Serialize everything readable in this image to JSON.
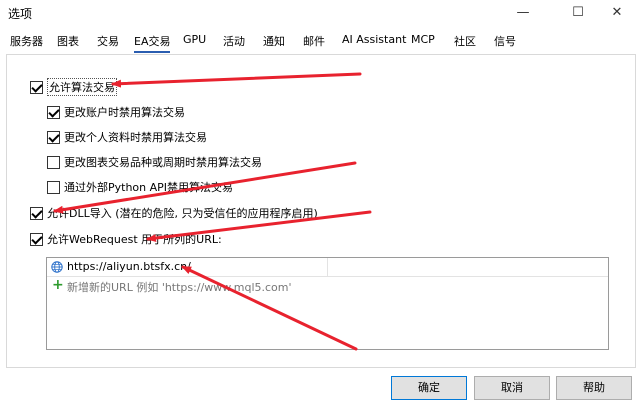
{
  "window": {
    "title": "选项",
    "minimize_glyph": "—",
    "maximize_glyph": "☐",
    "close_glyph": "✕"
  },
  "tabs": [
    {
      "label": "服务器"
    },
    {
      "label": "图表"
    },
    {
      "label": "交易"
    },
    {
      "label": "EA交易",
      "active": true
    },
    {
      "label": "GPU"
    },
    {
      "label": "活动"
    },
    {
      "label": "通知"
    },
    {
      "label": "邮件"
    },
    {
      "label": "AI Assistant"
    },
    {
      "label": "MCP"
    },
    {
      "label": "社区"
    },
    {
      "label": "信号"
    }
  ],
  "options": {
    "allow_algo": {
      "label": "允许算法交易",
      "checked": true
    },
    "disable_on_account_change": {
      "label": "更改账户时禁用算法交易",
      "checked": true
    },
    "disable_on_profile_change": {
      "label": "更改个人资料时禁用算法交易",
      "checked": true
    },
    "disable_on_symbol_change": {
      "label": "更改图表交易品种或周期时禁用算法交易",
      "checked": false
    },
    "disable_external_python": {
      "label": "通过外部Python API禁用算法交易",
      "checked": false
    },
    "allow_dll": {
      "label": "允许DLL导入 (潜在的危险, 只为受信任的应用程序启用)",
      "checked": true
    },
    "allow_webrequest": {
      "label": "允许WebRequest 用于所列的URL:",
      "checked": true
    }
  },
  "url_list": {
    "entries": [
      "https://aliyun.btsfx.cn/"
    ],
    "add_placeholder": "新增新的URL 例如 'https://www.mql5.com'"
  },
  "buttons": {
    "ok": "确定",
    "cancel": "取消",
    "help": "帮助"
  },
  "colors": {
    "annotation_arrow": "#e8222e",
    "tab_underline": "#2a5db0",
    "add_icon": "#2e9b2e"
  }
}
